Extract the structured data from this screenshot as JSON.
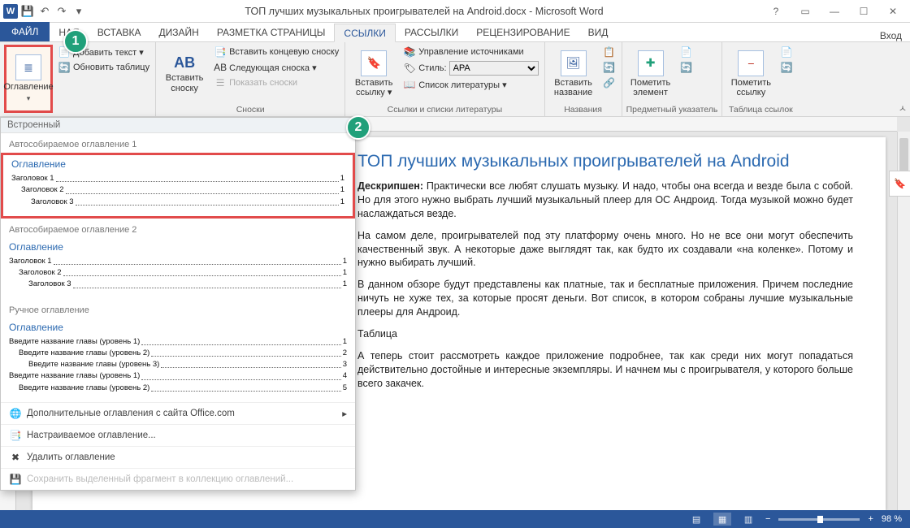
{
  "titlebar": {
    "title": "ТОП лучших музыкальных проигрывателей на Android.docx - Microsoft Word"
  },
  "tabs": {
    "file": "ФАЙЛ",
    "items": [
      "НАЯ",
      "ВСТАВКА",
      "ДИЗАЙН",
      "РАЗМЕТКА СТРАНИЦЫ",
      "ССЫЛКИ",
      "РАССЫЛКИ",
      "РЕЦЕНЗИРОВАНИЕ",
      "ВИД"
    ],
    "active_index": 4,
    "signin": "Вход"
  },
  "ribbon": {
    "toc": {
      "btn": "Оглавление",
      "add_text": "Добавить текст ▾",
      "update": "Обновить таблицу",
      "group_hidden": ""
    },
    "footnotes": {
      "insert": "Вставить\nсноску",
      "ab": "AB",
      "end": "Вставить концевую сноску",
      "next": "Следующая сноска ▾",
      "show": "Показать сноски",
      "group": "Сноски"
    },
    "citations": {
      "insert": "Вставить\nссылку ▾",
      "manage": "Управление источниками",
      "style_label": "Стиль:",
      "style_value": "APA",
      "biblio": "Список литературы ▾",
      "group": "Ссылки и списки литературы"
    },
    "captions": {
      "insert": "Вставить\nназвание",
      "group": "Названия"
    },
    "index": {
      "mark": "Пометить\nэлемент",
      "group": "Предметный указатель"
    },
    "toa": {
      "mark": "Пометить\nссылку",
      "group": "Таблица ссылок"
    }
  },
  "badges": {
    "one": "1",
    "two": "2"
  },
  "gallery": {
    "header": "Встроенный",
    "sec1_title": "Автособираемое оглавление 1",
    "sec1_toc_title": "Оглавление",
    "sec1_items": [
      {
        "text": "Заголовок 1",
        "page": "1",
        "indent": 0
      },
      {
        "text": "Заголовок 2",
        "page": "1",
        "indent": 1
      },
      {
        "text": "Заголовок 3",
        "page": "1",
        "indent": 2
      }
    ],
    "sec2_title": "Автособираемое оглавление 2",
    "sec2_toc_title": "Оглавление",
    "sec2_items": [
      {
        "text": "Заголовок 1",
        "page": "1",
        "indent": 0
      },
      {
        "text": "Заголовок 2",
        "page": "1",
        "indent": 1
      },
      {
        "text": "Заголовок 3",
        "page": "1",
        "indent": 2
      }
    ],
    "sec3_title": "Ручное оглавление",
    "sec3_toc_title": "Оглавление",
    "sec3_items": [
      {
        "text": "Введите название главы (уровень 1)",
        "page": "1",
        "indent": 0
      },
      {
        "text": "Введите название главы (уровень 2)",
        "page": "2",
        "indent": 1
      },
      {
        "text": "Введите название главы (уровень 3)",
        "page": "3",
        "indent": 2
      },
      {
        "text": "Введите название главы (уровень 1)",
        "page": "4",
        "indent": 0
      },
      {
        "text": "Введите название главы (уровень 2)",
        "page": "5",
        "indent": 1
      }
    ],
    "footer": {
      "more": "Дополнительные оглавления с сайта Office.com",
      "custom": "Настраиваемое оглавление...",
      "remove": "Удалить оглавление",
      "save": "Сохранить выделенный фрагмент в коллекцию оглавлений..."
    }
  },
  "document": {
    "h1": "ТОП лучших музыкальных проигрывателей на Android",
    "p1_label": "Дескрипшен:",
    "p1": " Практически все любят слушать музыку. И надо, чтобы она всегда и везде была с собой. Но для этого нужно выбрать лучший музыкальный плеер для ОС Андроид. Тогда музыкой можно будет наслаждаться везде.",
    "p2": "На самом деле, проигрывателей под эту платформу очень много. Но не все они могут обеспечить качественный звук. А некоторые даже выглядят так, как будто их создавали «на коленке». Потому и нужно выбирать лучший.",
    "p3": "В данном обзоре будут представлены как платные, так и бесплатные приложения. Причем последние ничуть не хуже тех, за которые просят деньги. Вот список, в котором собраны лучшие музыкальные плееры для Андроид.",
    "p4": "Таблица",
    "p5": "А теперь стоит рассмотреть каждое приложение подробнее, так как среди них могут попадаться действительно достойные и интересные экземпляры. И начнем мы с проигрывателя, у которого больше всего закачек."
  },
  "status": {
    "zoom": "98 %"
  }
}
